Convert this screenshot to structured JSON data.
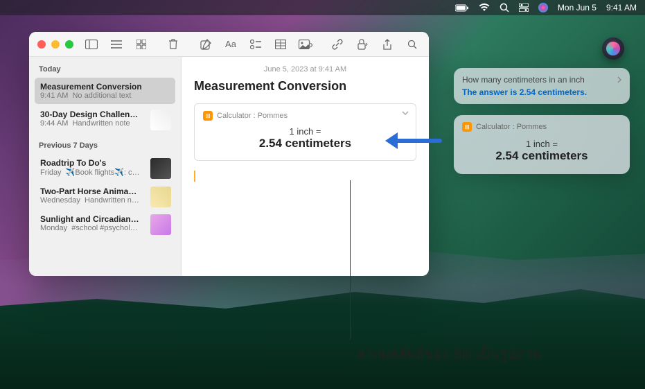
{
  "menubar": {
    "date": "Mon Jun 5",
    "time": "9:41 AM"
  },
  "notes": {
    "toolbar": {},
    "sidebar": {
      "section1": "Today",
      "section2": "Previous 7 Days",
      "items": [
        {
          "title": "Measurement Conversion",
          "time": "9:41 AM",
          "meta": "No additional text",
          "selected": true
        },
        {
          "title": "30-Day Design Challen…",
          "time": "9:44 AM",
          "meta": "Handwritten note"
        }
      ],
      "prev": [
        {
          "title": "Roadtrip To Do's",
          "time": "Friday",
          "meta": "✈️Book flights✈️: c…"
        },
        {
          "title": "Two-Part Horse Anima…",
          "time": "Wednesday",
          "meta": "Handwritten n…"
        },
        {
          "title": "Sunlight and Circadian…",
          "time": "Monday",
          "meta": "#school #psychol…"
        }
      ]
    },
    "editor": {
      "date": "June 5, 2023 at 9:41 AM",
      "title": "Measurement Conversion",
      "calc": {
        "source": "Calculator : Pommes",
        "equation": "1 inch =",
        "result": "2.54 centimeters"
      }
    }
  },
  "siri": {
    "query": "How many centimeters in an inch",
    "answer": "The answer is 2.54 centimeters.",
    "calc": {
      "source": "Calculator : Pommes",
      "equation": "1 inch =",
      "result": "2.54 centimeters"
    }
  },
  "callout": "ลากผลลัพธ์ของ Siri เป็นรูปภาพ"
}
